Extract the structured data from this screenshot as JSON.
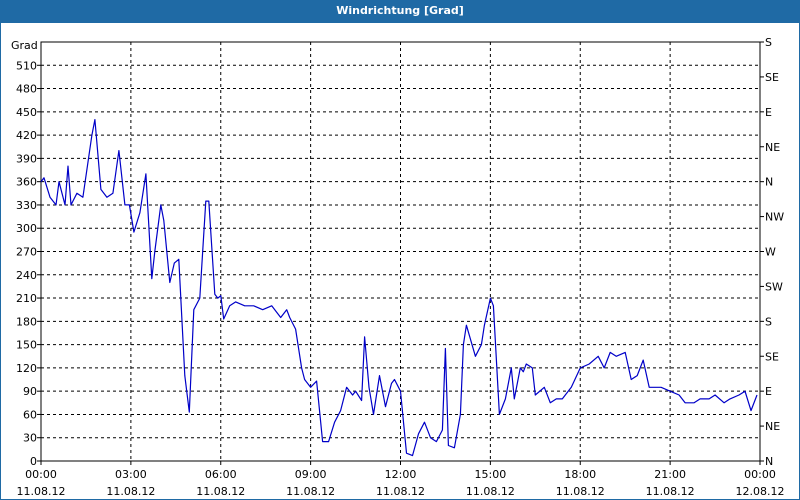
{
  "window": {
    "title": "Windrichtung [Grad]"
  },
  "colors": {
    "titlebar": "#1f6aa5",
    "line": "#0000c8",
    "grid": "#000000"
  },
  "chart_data": {
    "type": "line",
    "title": "Windrichtung [Grad]",
    "ylabel": "Grad",
    "ylim": [
      0,
      540
    ],
    "yticks": [
      0,
      30,
      60,
      90,
      120,
      150,
      180,
      210,
      240,
      270,
      300,
      330,
      360,
      390,
      420,
      450,
      480,
      510
    ],
    "right_ticks": [
      {
        "v": 0,
        "label": "N"
      },
      {
        "v": 45,
        "label": "NE"
      },
      {
        "v": 90,
        "label": "E"
      },
      {
        "v": 135,
        "label": "SE"
      },
      {
        "v": 180,
        "label": "S"
      },
      {
        "v": 225,
        "label": "SW"
      },
      {
        "v": 270,
        "label": "W"
      },
      {
        "v": 315,
        "label": "NW"
      },
      {
        "v": 360,
        "label": "N"
      },
      {
        "v": 405,
        "label": "NE"
      },
      {
        "v": 450,
        "label": "E"
      },
      {
        "v": 495,
        "label": "SE"
      },
      {
        "v": 540,
        "label": "S"
      }
    ],
    "xlim": [
      0,
      24
    ],
    "xticks": [
      {
        "h": 0,
        "time": "00:00",
        "date": "11.08.12"
      },
      {
        "h": 3,
        "time": "03:00",
        "date": "11.08.12"
      },
      {
        "h": 6,
        "time": "06:00",
        "date": "11.08.12"
      },
      {
        "h": 9,
        "time": "09:00",
        "date": "11.08.12"
      },
      {
        "h": 12,
        "time": "12:00",
        "date": "11.08.12"
      },
      {
        "h": 15,
        "time": "15:00",
        "date": "11.08.12"
      },
      {
        "h": 18,
        "time": "18:00",
        "date": "11.08.12"
      },
      {
        "h": 21,
        "time": "21:00",
        "date": "11.08.12"
      },
      {
        "h": 24,
        "time": "00:00",
        "date": "12.08.12"
      }
    ],
    "grid": true,
    "series": [
      {
        "x": [
          0,
          0.1,
          0.3,
          0.5,
          0.6,
          0.8,
          0.9,
          1.0,
          1.2,
          1.4,
          1.7,
          1.8,
          2.0,
          2.2,
          2.4,
          2.6,
          2.8,
          2.95,
          3.1,
          3.3,
          3.5,
          3.7,
          3.8,
          4.0,
          4.1,
          4.3,
          4.45,
          4.6,
          4.8,
          4.95,
          5.1,
          5.3,
          5.5,
          5.6,
          5.8,
          5.9,
          6.0,
          6.1,
          6.3,
          6.5,
          6.8,
          7.1,
          7.4,
          7.7,
          8.0,
          8.2,
          8.3,
          8.5,
          8.7,
          8.8,
          9.0,
          9.2,
          9.4,
          9.6,
          9.8,
          10.0,
          10.2,
          10.4,
          10.5,
          10.7,
          10.8,
          10.95,
          11.1,
          11.3,
          11.5,
          11.7,
          11.8,
          12.0,
          12.2,
          12.4,
          12.6,
          12.8,
          13.0,
          13.2,
          13.4,
          13.5,
          13.6,
          13.8,
          14.0,
          14.1,
          14.2,
          14.5,
          14.7,
          14.8,
          15.0,
          15.1,
          15.3,
          15.5,
          15.7,
          15.8,
          16.0,
          16.1,
          16.2,
          16.4,
          16.5,
          16.8,
          17.0,
          17.2,
          17.4,
          17.7,
          18.0,
          18.3,
          18.6,
          18.8,
          19.0,
          19.2,
          19.5,
          19.7,
          19.9,
          20.1,
          20.3,
          20.5,
          20.7,
          21.0,
          21.3,
          21.5,
          21.8,
          22.0,
          22.3,
          22.5,
          22.8,
          23.0,
          23.3,
          23.5,
          23.7,
          23.9
        ],
        "y": [
          360,
          365,
          340,
          330,
          360,
          330,
          380,
          330,
          345,
          340,
          420,
          440,
          350,
          340,
          345,
          400,
          330,
          330,
          295,
          320,
          370,
          235,
          270,
          330,
          310,
          230,
          255,
          260,
          110,
          63,
          195,
          210,
          335,
          335,
          215,
          210,
          213,
          183,
          200,
          205,
          200,
          200,
          195,
          200,
          185,
          195,
          185,
          170,
          120,
          105,
          95,
          103,
          25,
          25,
          50,
          65,
          95,
          85,
          90,
          78,
          160,
          95,
          60,
          110,
          70,
          100,
          105,
          90,
          10,
          7,
          35,
          50,
          30,
          25,
          40,
          145,
          20,
          17,
          60,
          150,
          175,
          135,
          150,
          175,
          210,
          200,
          60,
          80,
          120,
          80,
          120,
          115,
          125,
          120,
          85,
          95,
          75,
          80,
          80,
          95,
          120,
          125,
          135,
          120,
          140,
          135,
          140,
          105,
          110,
          130,
          95,
          95,
          95,
          90,
          85,
          75,
          75,
          80,
          80,
          85,
          75,
          80,
          85,
          90,
          65,
          85
        ]
      }
    ]
  }
}
